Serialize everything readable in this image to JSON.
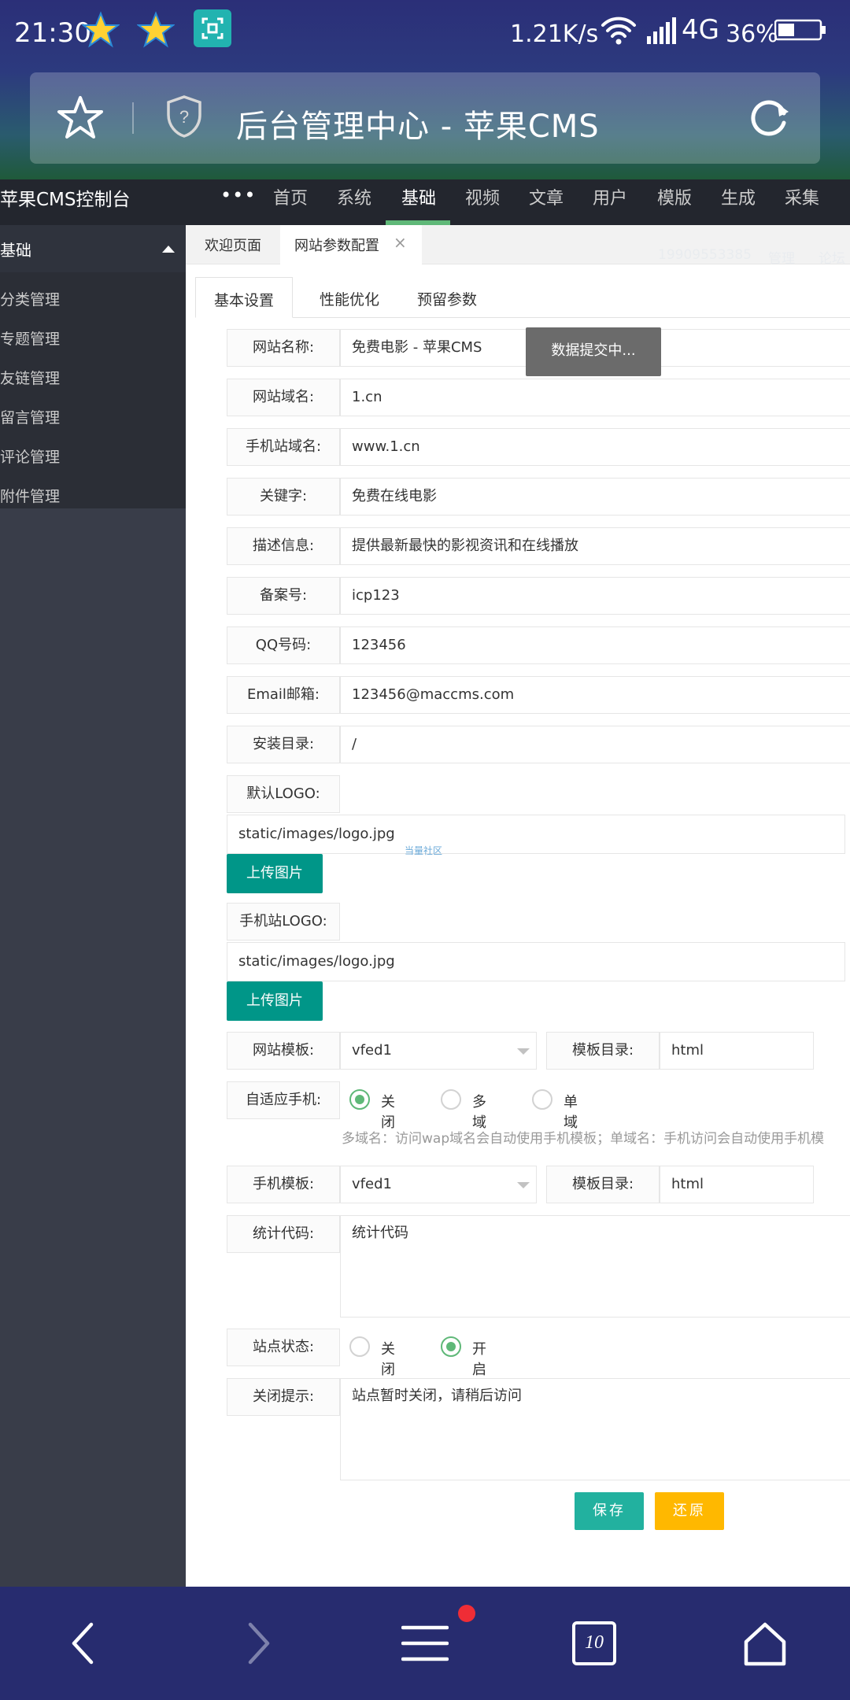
{
  "status_bar": {
    "time": "21:30",
    "speed": "1.21K/s",
    "network": "4G",
    "battery": "36%"
  },
  "browser": {
    "title": "后台管理中心 - 苹果CMS"
  },
  "cms": {
    "brand": "苹果CMS控制台",
    "nav_more": "•••",
    "nav": [
      "首页",
      "系统",
      "基础",
      "视频",
      "文章",
      "用户",
      "模版",
      "生成",
      "采集"
    ],
    "active_nav": "基础",
    "header_right": [
      "19909553385",
      "管理",
      "论坛"
    ]
  },
  "sidebar": {
    "section": "基础",
    "items": [
      "分类管理",
      "专题管理",
      "友链管理",
      "留言管理",
      "评论管理",
      "附件管理"
    ]
  },
  "tabs": {
    "welcome": "欢迎页面",
    "current": "网站参数配置",
    "close_glyph": "×"
  },
  "subtabs": [
    "基本设置",
    "性能优化",
    "预留参数"
  ],
  "form": {
    "site_name": {
      "label": "网站名称:",
      "value": "免费电影 - 苹果CMS"
    },
    "site_domain": {
      "label": "网站域名:",
      "value": "1.cn"
    },
    "mobile_domain": {
      "label": "手机站域名:",
      "value": "www.1.cn"
    },
    "keywords": {
      "label": "关键字:",
      "value": "免费在线电影"
    },
    "description": {
      "label": "描述信息:",
      "value": "提供最新最快的影视资讯和在线播放"
    },
    "icp": {
      "label": "备案号:",
      "value": "icp123"
    },
    "qq": {
      "label": "QQ号码:",
      "value": "123456"
    },
    "email": {
      "label": "Email邮箱:",
      "value": "123456@maccms.com"
    },
    "install_dir": {
      "label": "安装目录:",
      "value": "/"
    },
    "logo": {
      "label": "默认LOGO:",
      "value": "static/images/logo.jpg",
      "button": "上传图片"
    },
    "mobile_logo": {
      "label": "手机站LOGO:",
      "value": "static/images/logo.jpg",
      "button": "上传图片"
    },
    "site_template": {
      "label": "网站模板:",
      "value": "vfed1",
      "dir_label": "模板目录:",
      "dir_value": "html"
    },
    "adaptive": {
      "label": "自适应手机:",
      "options": [
        "关闭",
        "多域",
        "单域"
      ],
      "selected": "关闭",
      "hint": "多域名：访问wap域名会自动使用手机模板；单域名：手机访问会自动使用手机模"
    },
    "mobile_template": {
      "label": "手机模板:",
      "value": "vfed1",
      "dir_label": "模板目录:",
      "dir_value": "html"
    },
    "stat_code": {
      "label": "统计代码:",
      "value": "统计代码"
    },
    "site_status": {
      "label": "站点状态:",
      "options": [
        "关闭",
        "开启"
      ],
      "selected": "开启"
    },
    "close_tip": {
      "label": "关闭提示:",
      "value": "站点暂时关闭，请稍后访问"
    }
  },
  "toast": "数据提交中...",
  "watermark": "当量社区",
  "buttons": {
    "save": "保存",
    "reset": "还原"
  },
  "bottom_bar": {
    "tabs_count": "10"
  },
  "colors": {
    "accent_green": "#009688",
    "active_radio": "#5fb878",
    "reset_yellow": "#ffb800",
    "sidebar": "#393d49"
  }
}
